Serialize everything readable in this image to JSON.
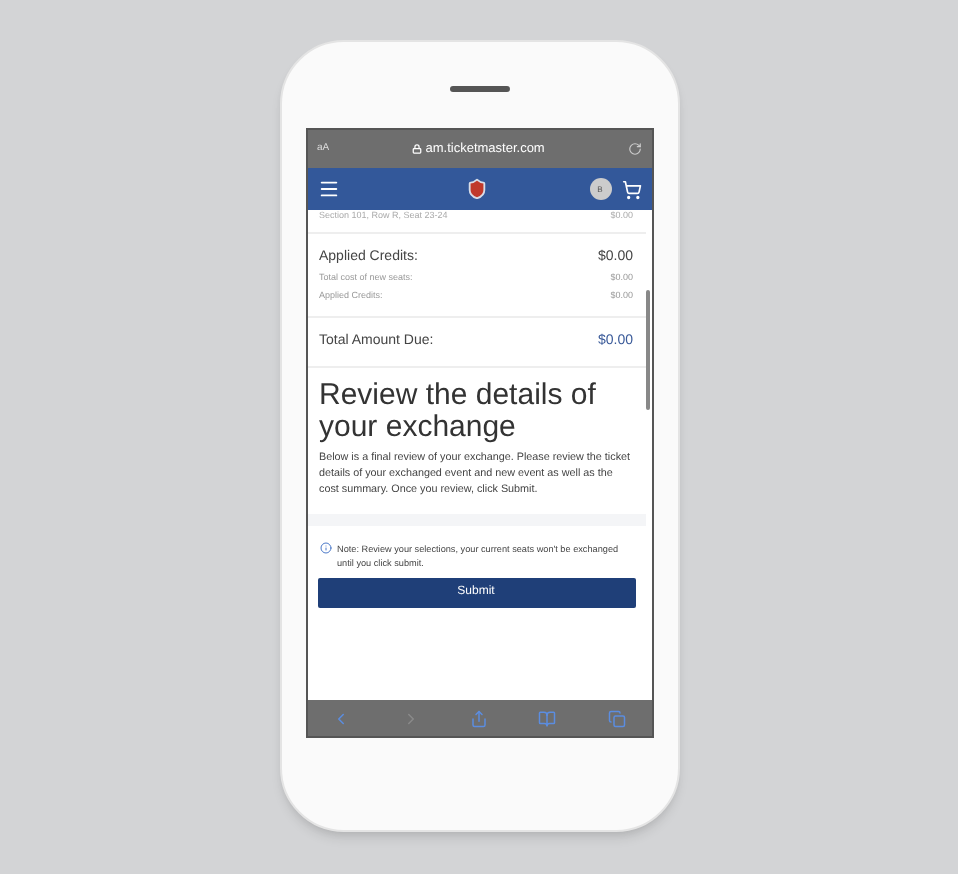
{
  "browser_bar": {
    "text_size": "aA",
    "url": "am.ticketmaster.com"
  },
  "nav_bar": {
    "avatar": "B"
  },
  "seat_line": {
    "label": "Section 101, Row R, Seat 23-24",
    "amount": "$0.00"
  },
  "credits": {
    "title": "Applied Credits:",
    "amount": "$0.00",
    "lines": [
      {
        "label": "Total cost of new seats:",
        "amount": "$0.00"
      },
      {
        "label": "Applied Credits:",
        "amount": "$0.00"
      }
    ]
  },
  "total": {
    "label": "Total Amount Due:",
    "amount": "$0.00"
  },
  "heading": "Review the details of your exchange",
  "description": "Below is a final review of your exchange. Please review the ticket details of your exchanged event and new event as well as the cost summary. Once you review, click Submit.",
  "note": "Note: Review your selections, your current seats won't be exchanged until you click submit.",
  "submit_button": "Submit",
  "toolbar": [
    {
      "kind": "back",
      "disabled": false
    },
    {
      "kind": "forward",
      "disabled": true
    },
    {
      "kind": "share",
      "disabled": false
    },
    {
      "kind": "bookmarks",
      "disabled": false
    },
    {
      "kind": "tabs",
      "disabled": false
    }
  ]
}
